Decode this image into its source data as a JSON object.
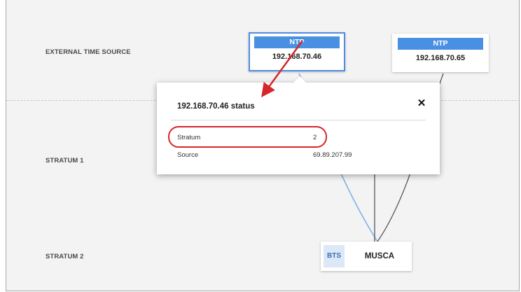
{
  "tiers": {
    "external": "EXTERNAL TIME SOURCE",
    "stratum1": "STRATUM 1",
    "stratum2": "STRATUM 2"
  },
  "external_sources": [
    {
      "tag": "NTP",
      "address": "192.168.70.46",
      "selected": true
    },
    {
      "tag": "NTP",
      "address": "192.168.70.65",
      "selected": false
    }
  ],
  "stratum2_node": {
    "tag": "BTS",
    "name": "MUSCA"
  },
  "status_popup": {
    "title": "192.168.70.46 status",
    "close_glyph": "✕",
    "rows": [
      {
        "label": "Stratum",
        "value": "2"
      },
      {
        "label": "Source",
        "value": "69.89.207.99"
      }
    ]
  },
  "colors": {
    "accent": "#4a90e2",
    "highlight": "#d6262b",
    "link_selected": "#7db3ea",
    "link_default": "#555555"
  }
}
